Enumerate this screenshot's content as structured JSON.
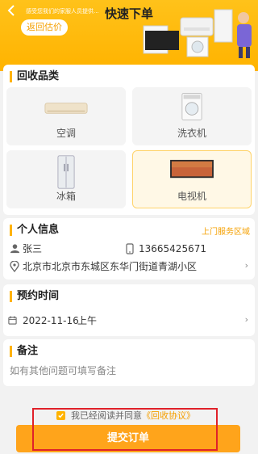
{
  "header": {
    "title": "快速下单",
    "marquee": "感受您我们的家服人员提供...",
    "back_estimate_label": "返回估价"
  },
  "category": {
    "title": "回收品类",
    "items": [
      {
        "label": "空调"
      },
      {
        "label": "洗衣机"
      },
      {
        "label": "冰箱"
      },
      {
        "label": "电视机"
      }
    ],
    "selected": "电视机"
  },
  "personal": {
    "title": "个人信息",
    "service_area_link": "上门服务区域",
    "name": "张三",
    "phone": "13665425671",
    "address": "北京市北京市东城区东华门街道青湖小区"
  },
  "appointment": {
    "title": "预约时间",
    "date": "2022-11-16",
    "period": "上午"
  },
  "remark": {
    "title": "备注",
    "placeholder": "如有其他问题可填写备注"
  },
  "footer": {
    "agree_text": "我已经阅读并同意",
    "agreement_link": "《回收协议》",
    "submit_label": "提交订单",
    "agree_checked": true
  },
  "colors": {
    "accent": "#ffb300",
    "link": "#f5a000",
    "submit": "#ffa41b",
    "highlight_box": "#e0212a"
  }
}
